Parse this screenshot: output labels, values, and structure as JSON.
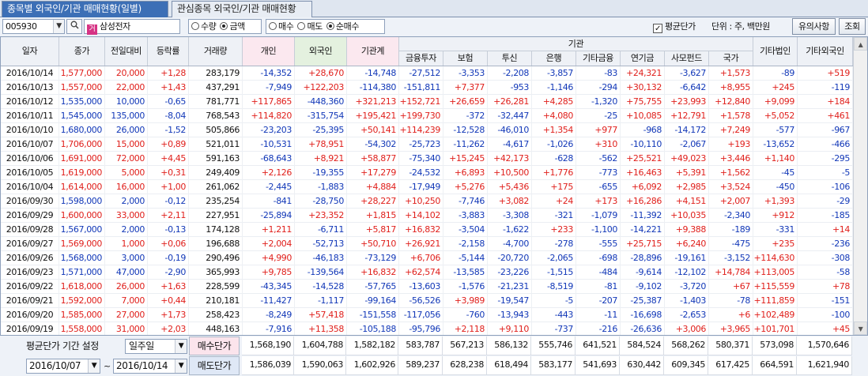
{
  "tabs": {
    "active": "종목별 외국인/기관 매매현황(일별)",
    "inactive": "관심종목 외국인/기관 매매현황"
  },
  "toolbar": {
    "code": "005930",
    "stock_name": "삼성전자",
    "stock_tag": "거",
    "radio_group1": [
      {
        "label": "수량",
        "checked": false
      },
      {
        "label": "금액",
        "checked": true
      }
    ],
    "radio_group2": [
      {
        "label": "매수",
        "checked": false
      },
      {
        "label": "매도",
        "checked": false
      },
      {
        "label": "순매수",
        "checked": true
      }
    ],
    "avg_price_label": "평균단가",
    "avg_price_checked": true,
    "unit_label": "단위 : 주, 백만원",
    "notice_button": "유의사항",
    "query_button": "조회"
  },
  "columns": {
    "date": "일자",
    "close": "종가",
    "change": "전일대비",
    "rate": "등락률",
    "volume": "거래량",
    "individual": "개인",
    "foreign": "외국인",
    "inst_total": "기관계",
    "institution_group": "기관",
    "finance": "금융투자",
    "insurance": "보험",
    "trust": "투신",
    "bank": "은행",
    "other_fin": "기타금융",
    "pension": "연기금",
    "private_fund": "사모펀드",
    "state": "국가",
    "other_corp": "기타법인",
    "other_foreign": "기타외국인"
  },
  "rows": [
    [
      "2016/10/14",
      "1,577,000",
      "20,000",
      "+1,28",
      "283,179",
      "-14,352",
      "+28,670",
      "-14,748",
      "-27,512",
      "-3,353",
      "-2,208",
      "-3,857",
      "-83",
      "+24,321",
      "-3,627",
      "+1,573",
      "-89",
      "+519"
    ],
    [
      "2016/10/13",
      "1,557,000",
      "22,000",
      "+1,43",
      "437,291",
      "-7,949",
      "+122,203",
      "-114,380",
      "-151,811",
      "+7,377",
      "-953",
      "-1,146",
      "-294",
      "+30,132",
      "-6,642",
      "+8,955",
      "+245",
      "-119"
    ],
    [
      "2016/10/12",
      "1,535,000",
      "10,000",
      "-0,65",
      "781,771",
      "+117,865",
      "-448,360",
      "+321,213",
      "+152,721",
      "+26,659",
      "+26,281",
      "+4,285",
      "-1,320",
      "+75,755",
      "+23,993",
      "+12,840",
      "+9,099",
      "+184"
    ],
    [
      "2016/10/11",
      "1,545,000",
      "135,000",
      "-8,04",
      "768,543",
      "+114,820",
      "-315,754",
      "+195,421",
      "+199,730",
      "-372",
      "-32,447",
      "+4,080",
      "-25",
      "+10,085",
      "+12,791",
      "+1,578",
      "+5,052",
      "+461"
    ],
    [
      "2016/10/10",
      "1,680,000",
      "26,000",
      "-1,52",
      "505,866",
      "-23,203",
      "-25,395",
      "+50,141",
      "+114,239",
      "-12,528",
      "-46,010",
      "+1,354",
      "+977",
      "-968",
      "-14,172",
      "+7,249",
      "-577",
      "-967"
    ],
    [
      "2016/10/07",
      "1,706,000",
      "15,000",
      "+0,89",
      "521,011",
      "-10,531",
      "+78,951",
      "-54,302",
      "-25,723",
      "-11,262",
      "-4,617",
      "-1,026",
      "+310",
      "-10,110",
      "-2,067",
      "+193",
      "-13,652",
      "-466"
    ],
    [
      "2016/10/06",
      "1,691,000",
      "72,000",
      "+4,45",
      "591,163",
      "-68,643",
      "+8,921",
      "+58,877",
      "-75,340",
      "+15,245",
      "+42,173",
      "-628",
      "-562",
      "+25,521",
      "+49,023",
      "+3,446",
      "+1,140",
      "-295"
    ],
    [
      "2016/10/05",
      "1,619,000",
      "5,000",
      "+0,31",
      "249,409",
      "+2,126",
      "-19,355",
      "+17,279",
      "-24,532",
      "+6,893",
      "+10,500",
      "+1,776",
      "-773",
      "+16,463",
      "+5,391",
      "+1,562",
      "-45",
      "-5"
    ],
    [
      "2016/10/04",
      "1,614,000",
      "16,000",
      "+1,00",
      "261,062",
      "-2,445",
      "-1,883",
      "+4,884",
      "-17,949",
      "+5,276",
      "+5,436",
      "+175",
      "-655",
      "+6,092",
      "+2,985",
      "+3,524",
      "-450",
      "-106"
    ],
    [
      "2016/09/30",
      "1,598,000",
      "2,000",
      "-0,12",
      "235,254",
      "-841",
      "-28,750",
      "+28,227",
      "+10,250",
      "-7,746",
      "+3,082",
      "+24",
      "+173",
      "+16,286",
      "+4,151",
      "+2,007",
      "+1,393",
      "-29"
    ],
    [
      "2016/09/29",
      "1,600,000",
      "33,000",
      "+2,11",
      "227,951",
      "-25,894",
      "+23,352",
      "+1,815",
      "+14,102",
      "-3,883",
      "-3,308",
      "-321",
      "-1,079",
      "-11,392",
      "+10,035",
      "-2,340",
      "+912",
      "-185"
    ],
    [
      "2016/09/28",
      "1,567,000",
      "2,000",
      "-0,13",
      "174,128",
      "+1,211",
      "-6,711",
      "+5,817",
      "+16,832",
      "-3,504",
      "-1,622",
      "+233",
      "-1,100",
      "-14,221",
      "+9,388",
      "-189",
      "-331",
      "+14"
    ],
    [
      "2016/09/27",
      "1,569,000",
      "1,000",
      "+0,06",
      "196,688",
      "+2,004",
      "-52,713",
      "+50,710",
      "+26,921",
      "-2,158",
      "-4,700",
      "-278",
      "-555",
      "+25,715",
      "+6,240",
      "-475",
      "+235",
      "-236"
    ],
    [
      "2016/09/26",
      "1,568,000",
      "3,000",
      "-0,19",
      "290,496",
      "+4,990",
      "-46,183",
      "-73,129",
      "+6,706",
      "-5,144",
      "-20,720",
      "-2,065",
      "-698",
      "-28,896",
      "-19,161",
      "-3,152",
      "+114,630",
      "-308"
    ],
    [
      "2016/09/23",
      "1,571,000",
      "47,000",
      "-2,90",
      "365,993",
      "+9,785",
      "-139,564",
      "+16,832",
      "+62,574",
      "-13,585",
      "-23,226",
      "-1,515",
      "-484",
      "-9,614",
      "-12,102",
      "+14,784",
      "+113,005",
      "-58"
    ],
    [
      "2016/09/22",
      "1,618,000",
      "26,000",
      "+1,63",
      "228,599",
      "-43,345",
      "-14,528",
      "-57,765",
      "-13,603",
      "-1,576",
      "-21,231",
      "-8,519",
      "-81",
      "-9,102",
      "-3,720",
      "+67",
      "+115,559",
      "+78"
    ],
    [
      "2016/09/21",
      "1,592,000",
      "7,000",
      "+0,44",
      "210,181",
      "-11,427",
      "-1,117",
      "-99,164",
      "-56,526",
      "+3,989",
      "-19,547",
      "-5",
      "-207",
      "-25,387",
      "-1,403",
      "-78",
      "+111,859",
      "-151"
    ],
    [
      "2016/09/20",
      "1,585,000",
      "27,000",
      "+1,73",
      "258,423",
      "-8,249",
      "+57,418",
      "-151,558",
      "-117,056",
      "-760",
      "-13,943",
      "-443",
      "-11",
      "-16,698",
      "-2,653",
      "+6",
      "+102,489",
      "-100"
    ],
    [
      "2016/09/19",
      "1,558,000",
      "31,000",
      "+2,03",
      "448,163",
      "-7,916",
      "+11,358",
      "-105,188",
      "-95,796",
      "+2,118",
      "+9,110",
      "-737",
      "-216",
      "-26,636",
      "+3,006",
      "+3,965",
      "+101,701",
      "+45"
    ]
  ],
  "footer": {
    "period_label": "평균단가 기간 설정",
    "period_value": "일주일",
    "from_date": "2016/10/07",
    "to_date": "2016/10/14",
    "tilde": "~",
    "buy_label": "매수단가",
    "sell_label": "매도단가",
    "buy_values": [
      "1,568,190",
      "1,604,788",
      "1,582,182",
      "583,787",
      "567,213",
      "586,132",
      "555,746",
      "641,521",
      "584,524",
      "568,262",
      "580,371",
      "573,098",
      "1,570,646"
    ],
    "sell_values": [
      "1,586,039",
      "1,590,063",
      "1,602,926",
      "589,237",
      "628,238",
      "618,494",
      "583,177",
      "541,693",
      "630,442",
      "609,345",
      "617,425",
      "664,591",
      "1,621,940"
    ]
  },
  "colors": {
    "up": "#e0201c",
    "down": "#1238b8",
    "tab_active": "#3c6fb6"
  }
}
